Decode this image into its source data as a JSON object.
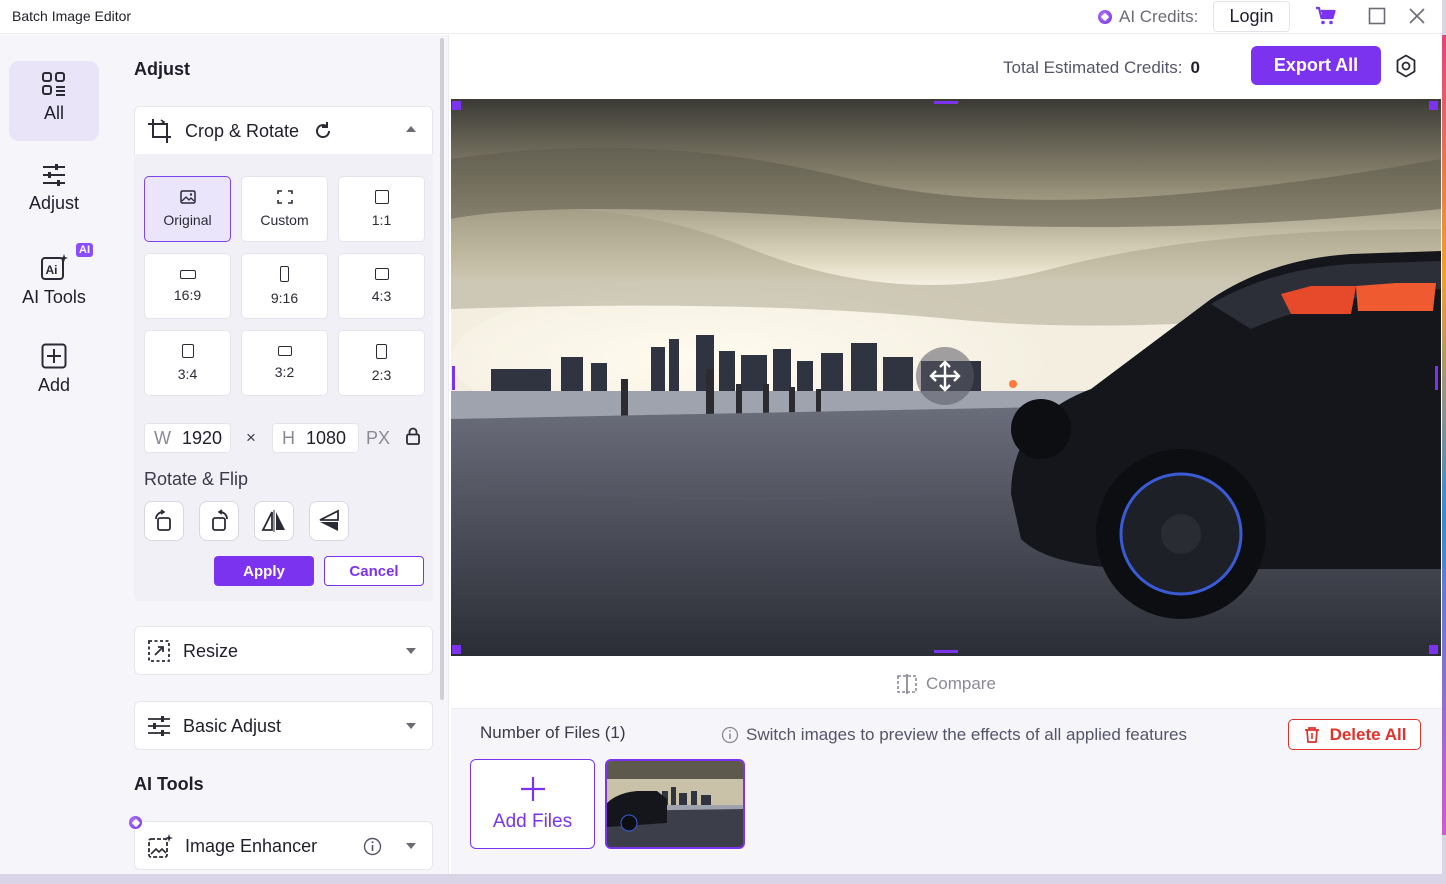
{
  "window": {
    "title": "Batch Image Editor",
    "ai_credits_label": "AI Credits:",
    "login_label": "Login"
  },
  "leftnav": {
    "items": [
      {
        "label": "All",
        "icon": "grid-icon"
      },
      {
        "label": "Adjust",
        "icon": "sliders-icon"
      },
      {
        "label": "AI Tools",
        "icon": "ai-tools-icon",
        "badge": "AI"
      },
      {
        "label": "Add",
        "icon": "plus-square-icon"
      }
    ]
  },
  "panel": {
    "adjust_title": "Adjust",
    "crop_rotate": {
      "title": "Crop & Rotate",
      "ratios": [
        {
          "label": "Original",
          "active": true
        },
        {
          "label": "Custom"
        },
        {
          "label": "1:1"
        },
        {
          "label": "16:9"
        },
        {
          "label": "9:16"
        },
        {
          "label": "4:3"
        },
        {
          "label": "3:4"
        },
        {
          "label": "3:2"
        },
        {
          "label": "2:3"
        }
      ],
      "width_key": "W",
      "width_value": "1920",
      "times": "×",
      "height_key": "H",
      "height_value": "1080",
      "unit": "PX",
      "rotate_flip_label": "Rotate & Flip",
      "apply_label": "Apply",
      "cancel_label": "Cancel"
    },
    "resize_label": "Resize",
    "basic_adjust_label": "Basic Adjust",
    "ai_tools_title": "AI Tools",
    "image_enhancer_label": "Image Enhancer"
  },
  "main": {
    "total_credits_label": "Total Estimated Credits:",
    "total_credits_value": "0",
    "export_label": "Export All",
    "compare_label": "Compare",
    "files_count_label": "Number of Files (1)",
    "hint_text": "Switch images to preview the effects of all applied features",
    "delete_all_label": "Delete All",
    "add_files_label": "Add Files"
  },
  "colors": {
    "accent": "#7b33f0",
    "danger": "#e0322a",
    "panel_bg": "#f6f5fa"
  }
}
